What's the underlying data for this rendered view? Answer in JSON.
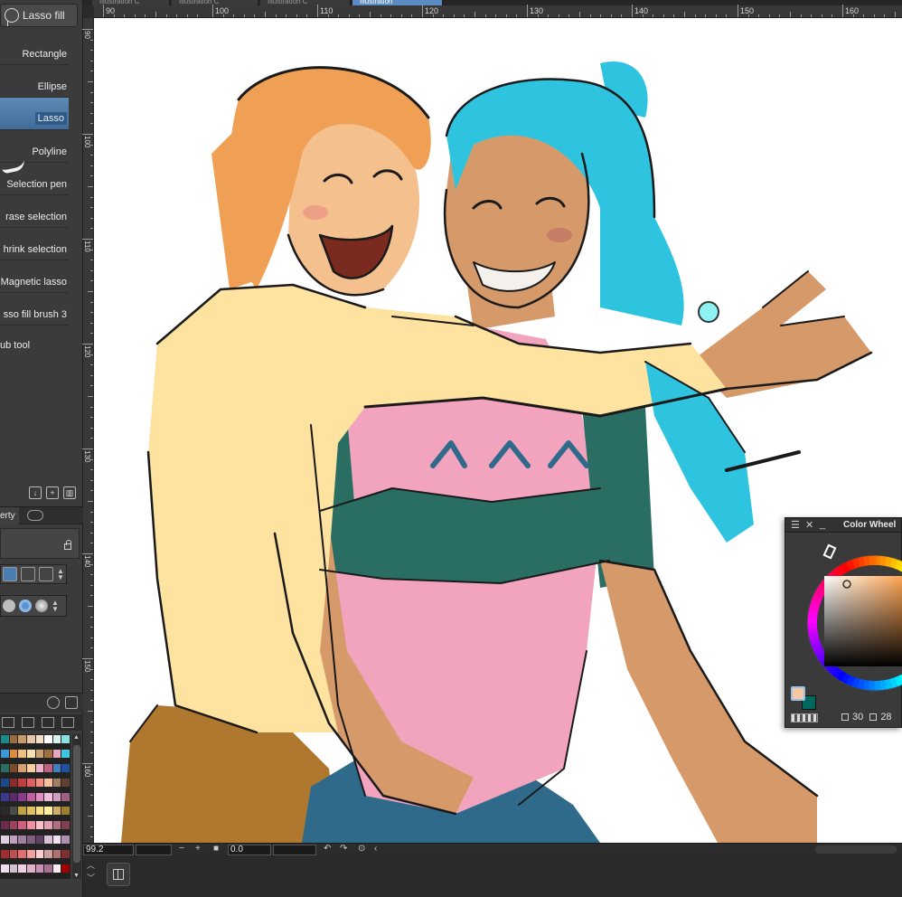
{
  "tool": {
    "current": "Lasso fill",
    "sub_tools": [
      "Rectangle",
      "Ellipse",
      "Lasso",
      "Polyline",
      "Selection pen",
      "rase selection",
      "hrink selection",
      "Magnetic lasso",
      "sso fill brush 3",
      "ub tool"
    ]
  },
  "property_panel": {
    "tab_label": "erty"
  },
  "document_tabs": [
    "Illustration C",
    "Illustration C",
    "Illustration C",
    "Illustration"
  ],
  "ruler": {
    "horizontal": [
      "90",
      "100",
      "110",
      "120",
      "130",
      "140",
      "150",
      "160"
    ],
    "vertical": [
      "90",
      "100",
      "110",
      "120",
      "130",
      "140",
      "150",
      "160"
    ]
  },
  "status": {
    "zoom": "99.2",
    "rotation": "0.0"
  },
  "color_wheel": {
    "title": "Color Wheel",
    "values": [
      "30",
      "28"
    ],
    "main_color": "#f7c8a2",
    "sub_color": "#00675f"
  },
  "colors": {
    "accent": "#4a7fb5",
    "panel_bg": "#3b3b3b",
    "canvas_bg": "#ffffff",
    "hair_orange": "#f0a054",
    "hair_blue": "#2ec4e0",
    "shirt_yellow": "#fde2a0",
    "shirt_pink": "#f2a4bf",
    "sleeve_teal": "#2a6e63",
    "skin_tan": "#d69a6a",
    "pants_blue": "#2f6a8a",
    "pants_brown": "#b0782e"
  }
}
